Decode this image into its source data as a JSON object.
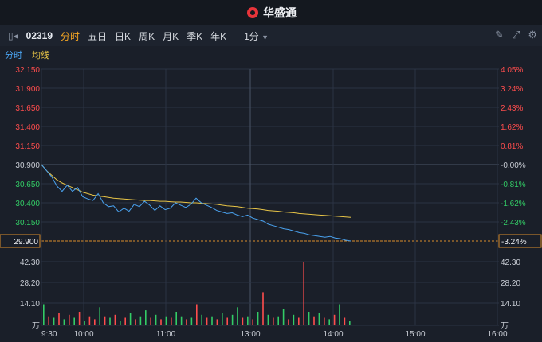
{
  "header": {
    "brand": "华盛通",
    "logo_icon": "brand-logo-icon"
  },
  "toolbar": {
    "symbol": "02319",
    "tabs": [
      "分时",
      "五日",
      "日K",
      "周K",
      "月K",
      "季K",
      "年K"
    ],
    "active_tab": "分时",
    "interval": "1分",
    "icons": [
      "pen-icon",
      "expand-icon",
      "settings-icon"
    ]
  },
  "subbar": {
    "line1": "分时",
    "line2": "均线"
  },
  "colors": {
    "price": "#4aa3f0",
    "avg": "#e8c547",
    "up": "#ff4d4d",
    "down": "#33cc66",
    "grid": "#2b3344"
  },
  "chart_data": {
    "type": "line",
    "price_axis": [
      "32.150",
      "31.900",
      "31.650",
      "31.400",
      "31.150",
      "30.900",
      "30.650",
      "30.400",
      "30.150",
      "29.900"
    ],
    "pct_axis": [
      "4.05%",
      "3.24%",
      "2.43%",
      "1.62%",
      "0.81%",
      "-0.00%",
      "-0.81%",
      "-1.62%",
      "-2.43%",
      "-3.24%"
    ],
    "vol_axis": [
      "42.30",
      "28.20",
      "14.10",
      "万"
    ],
    "time_axis": [
      "9:30",
      "10:00",
      "11:00",
      "13:00",
      "14:00",
      "15:00",
      "16:00"
    ],
    "current_price": "29.900",
    "current_pct": "-3.24%",
    "ylim": [
      29.9,
      32.15
    ],
    "price": [
      30.9,
      30.82,
      30.74,
      30.62,
      30.55,
      30.63,
      30.55,
      30.6,
      30.48,
      30.45,
      30.43,
      30.52,
      30.4,
      30.35,
      30.36,
      30.28,
      30.33,
      30.29,
      30.38,
      30.35,
      30.42,
      30.37,
      30.3,
      30.36,
      30.31,
      30.33,
      30.4,
      30.37,
      30.34,
      30.38,
      30.46,
      30.4,
      30.37,
      30.34,
      30.3,
      30.28,
      30.26,
      30.27,
      30.24,
      30.22,
      30.24,
      30.2,
      30.18,
      30.16,
      30.12,
      30.1,
      30.08,
      30.06,
      30.05,
      30.03,
      30.01,
      30.0,
      29.98,
      29.97,
      29.96,
      29.95,
      29.96,
      29.94,
      29.93,
      29.91,
      29.9
    ],
    "avg": [
      30.9,
      30.82,
      30.76,
      30.7,
      30.66,
      30.63,
      30.6,
      30.57,
      30.54,
      30.52,
      30.5,
      30.49,
      30.48,
      30.47,
      30.46,
      30.455,
      30.45,
      30.445,
      30.44,
      30.435,
      30.43,
      30.43,
      30.425,
      30.42,
      30.42,
      30.415,
      30.41,
      30.41,
      30.405,
      30.4,
      30.4,
      30.395,
      30.39,
      30.385,
      30.38,
      30.37,
      30.36,
      30.355,
      30.35,
      30.34,
      30.33,
      30.325,
      30.32,
      30.31,
      30.3,
      30.295,
      30.29,
      30.28,
      30.275,
      30.27,
      30.26,
      30.255,
      30.25,
      30.245,
      30.24,
      30.235,
      30.23,
      30.225,
      30.22,
      30.215,
      30.21
    ],
    "volume": [
      14,
      6,
      5,
      8,
      4,
      7,
      5,
      9,
      3,
      6,
      4,
      12,
      6,
      5,
      7,
      3,
      5,
      8,
      4,
      6,
      10,
      5,
      7,
      4,
      6,
      5,
      9,
      6,
      4,
      5,
      14,
      7,
      5,
      6,
      4,
      8,
      5,
      7,
      12,
      5,
      6,
      4,
      9,
      22,
      7,
      5,
      6,
      11,
      4,
      7,
      5,
      42,
      9,
      6,
      8,
      5,
      4,
      7,
      14,
      5,
      3
    ],
    "vol_up": [
      false,
      true,
      false,
      true,
      false,
      true,
      false,
      true,
      false,
      true,
      true,
      false,
      true,
      false,
      true,
      false,
      true,
      false,
      true,
      false,
      false,
      true,
      false,
      true,
      false,
      true,
      false,
      false,
      true,
      false,
      true,
      false,
      true,
      false,
      true,
      false,
      true,
      false,
      false,
      true,
      false,
      true,
      false,
      true,
      false,
      true,
      false,
      false,
      true,
      false,
      true,
      true,
      false,
      true,
      false,
      true,
      false,
      true,
      false,
      true,
      false
    ]
  }
}
